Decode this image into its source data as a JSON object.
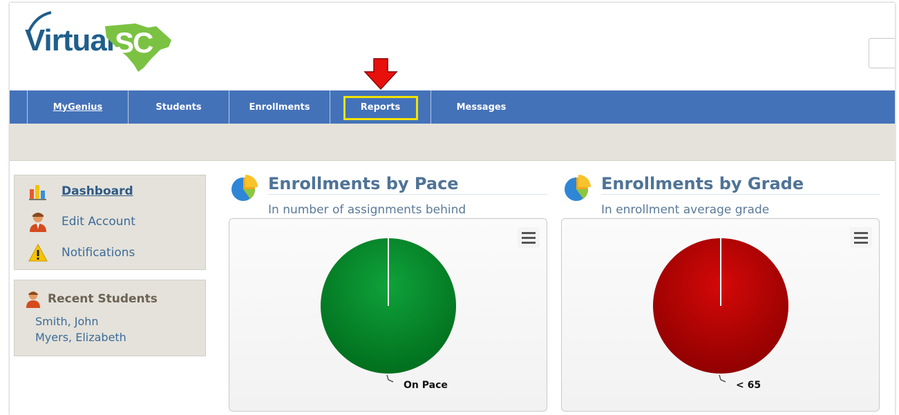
{
  "logo": {
    "text": "Virtual",
    "accent": "SC"
  },
  "nav": {
    "items": [
      {
        "label": "MyGenius",
        "active": true
      },
      {
        "label": "Students",
        "active": false
      },
      {
        "label": "Enrollments",
        "active": false
      },
      {
        "label": "Reports",
        "active": false,
        "highlighted": true
      },
      {
        "label": "Messages",
        "active": false
      }
    ]
  },
  "sidebar": {
    "menu": [
      {
        "label": "Dashboard",
        "icon": "bar-chart-icon",
        "current": true
      },
      {
        "label": "Edit Account",
        "icon": "user-icon",
        "current": false
      },
      {
        "label": "Notifications",
        "icon": "warning-icon",
        "current": false
      }
    ],
    "recent": {
      "title": "Recent Students",
      "students": [
        "Smith, John",
        "Myers, Elizabeth"
      ]
    }
  },
  "panels": [
    {
      "title": "Enrollments by Pace",
      "subtitle": "In number of assignments behind",
      "chart_data": {
        "type": "pie",
        "slices": [
          {
            "label": "On Pace",
            "value": 100,
            "color": "#0a8a2a"
          }
        ]
      }
    },
    {
      "title": "Enrollments by Grade",
      "subtitle": "In enrollment average grade",
      "chart_data": {
        "type": "pie",
        "slices": [
          {
            "label": "< 65",
            "value": 100,
            "color": "#c00000"
          }
        ]
      }
    }
  ],
  "colors": {
    "nav": "#4472b9",
    "highlight": "#f2e400",
    "arrow": "#e8100a"
  }
}
